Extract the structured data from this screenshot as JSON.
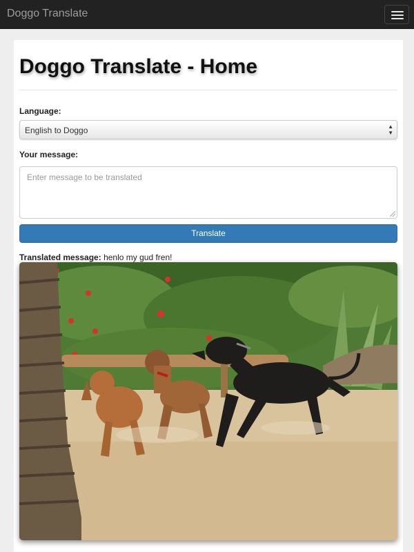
{
  "navbar": {
    "brand": "Doggo Translate",
    "menu_icon": "hamburger-menu-icon"
  },
  "page": {
    "title": "Doggo Translate - Home"
  },
  "form": {
    "language_label": "Language:",
    "language_selected": "English to Doggo",
    "message_label": "Your message:",
    "message_placeholder": "Enter message to be translated",
    "message_value": "",
    "translate_button": "Translate"
  },
  "result": {
    "label": "Translated message:",
    "text": "henlo my gud fren!"
  },
  "image": {
    "description_icon": "dogs-playing-photo"
  },
  "colors": {
    "navbar_bg": "#222222",
    "primary_button": "#337ab7",
    "page_bg": "#eeeeee"
  }
}
